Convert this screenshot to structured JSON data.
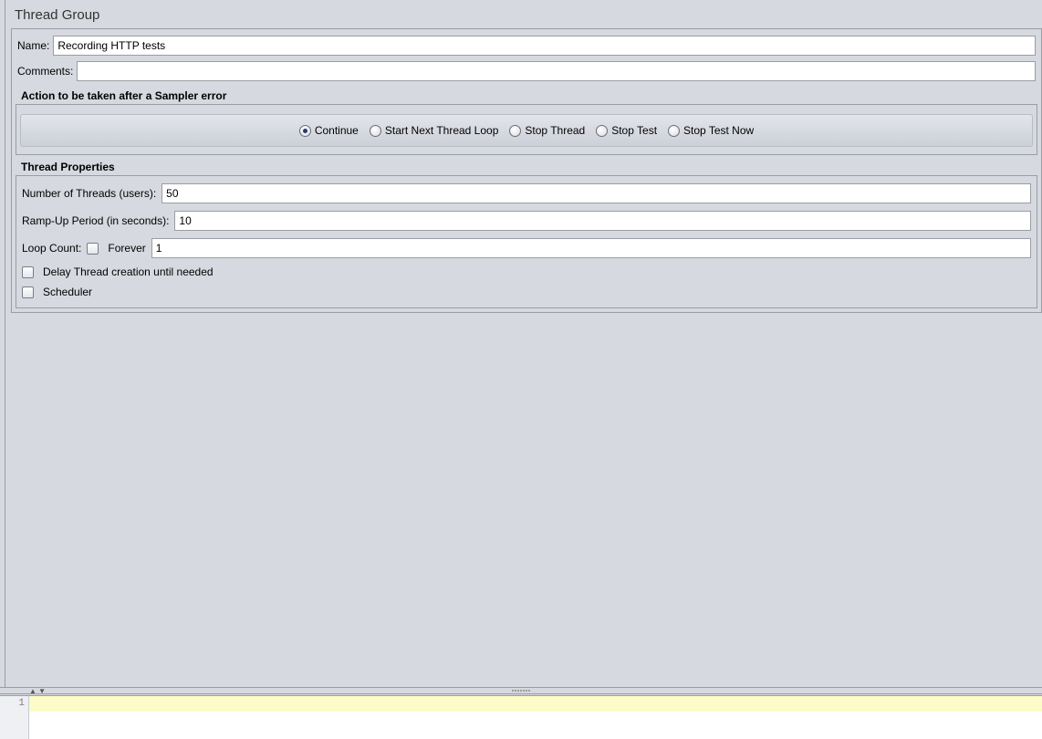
{
  "panel_title": "Thread Group",
  "name_label": "Name:",
  "name_value": "Recording HTTP tests",
  "comments_label": "Comments:",
  "comments_value": "",
  "sampler_error": {
    "legend": "Action to be taken after a Sampler error",
    "options": {
      "continue": "Continue",
      "start_next": "Start Next Thread Loop",
      "stop_thread": "Stop Thread",
      "stop_test": "Stop Test",
      "stop_test_now": "Stop Test Now"
    },
    "selected": "continue"
  },
  "thread_props": {
    "legend": "Thread Properties",
    "num_threads_label": "Number of Threads (users):",
    "num_threads_value": "50",
    "ramp_up_label": "Ramp-Up Period (in seconds):",
    "ramp_up_value": "10",
    "loop_count_label": "Loop Count:",
    "forever_label": "Forever",
    "loop_count_value": "1",
    "delay_label": "Delay Thread creation until needed",
    "scheduler_label": "Scheduler"
  },
  "line_number": "1"
}
